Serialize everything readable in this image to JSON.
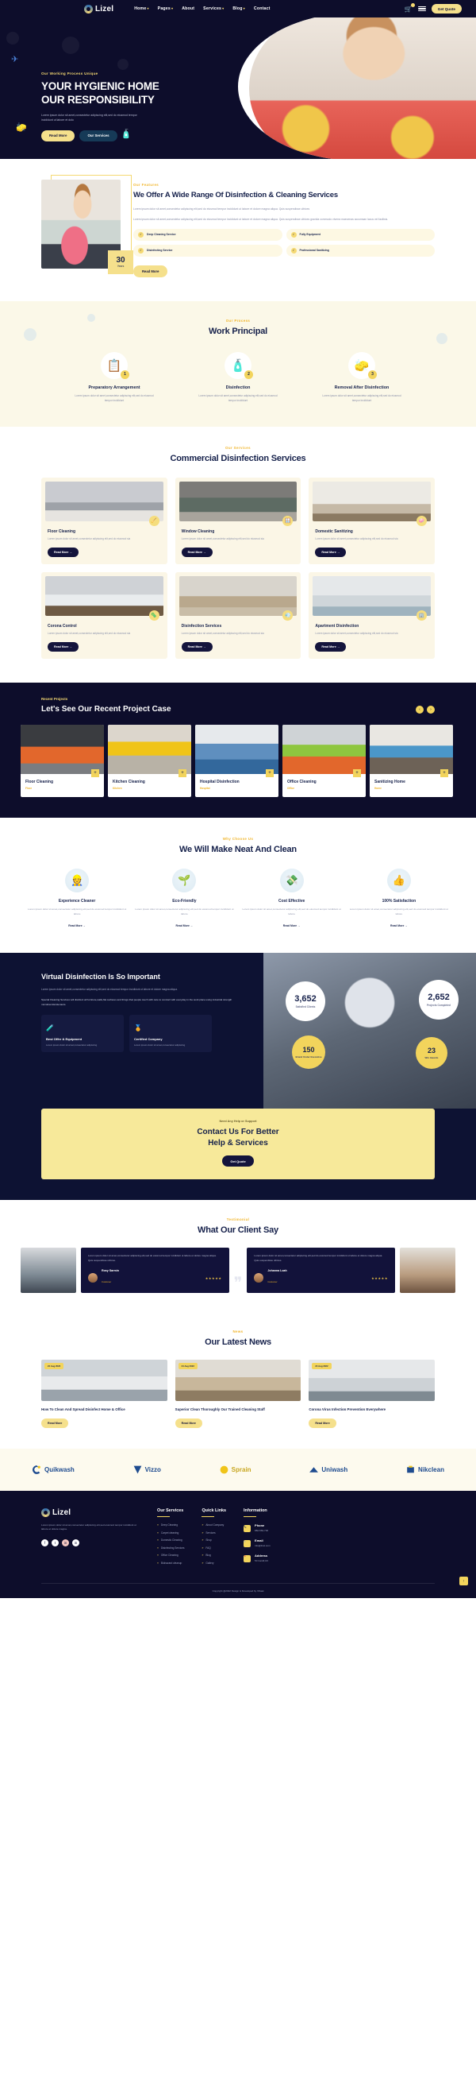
{
  "brand": {
    "name": "Lizel"
  },
  "header": {
    "nav": [
      {
        "label": "Home",
        "caret": "▾"
      },
      {
        "label": "Pages",
        "caret": "▾"
      },
      {
        "label": "About",
        "caret": ""
      },
      {
        "label": "Services",
        "caret": "▾"
      },
      {
        "label": "Blog",
        "caret": "▾"
      },
      {
        "label": "Contact",
        "caret": ""
      }
    ],
    "cart_icon": "🛒",
    "cart_count": "0",
    "quote_label": "Get Quote"
  },
  "hero": {
    "eyebrow": "Our Working Process Unique",
    "title_line1": "YOUR HYGIENIC HOME",
    "title_line2": "OUR RESPONSIBILITY",
    "paragraph": "Lorem ipsum dolor sit amet,consectetur adipiscing elit,sed do eiusmod tempor incididunt ut labore et dolo",
    "btn_primary": "Read More",
    "btn_secondary": "Our Services"
  },
  "offer": {
    "label": "Our Features",
    "title": "We Offer A Wide Range Of Disinfection & Cleaning Services",
    "p1": "Lorem ipsum dolor sit amet,consectetur adipiscing elit,sed do eiusmod tempor incididunt ut labore et dolore magna aliqua. Quis suspendisse ultrices",
    "p2": "Lorem ipsum dolor sit amet,consectetur adipiscing elit,sed do eiusmod tempor incididunt ut labore et dolore magna aliqua. Quis suspendisse ultrices gravida commodo viverra maecenas accumsan lacus vel facilisis.",
    "badge_number": "30",
    "badge_unit": "Years",
    "features": [
      {
        "label": "Deep Cleaning Service",
        "check": "✓"
      },
      {
        "label": "Fully Equipment",
        "check": "✓"
      },
      {
        "label": "Disinfecting Service",
        "check": "✓"
      },
      {
        "label": "Professional Sanitizing",
        "check": "✓"
      }
    ],
    "btn": "Read More"
  },
  "principal": {
    "label": "Our Process",
    "title": "Work Principal",
    "steps": [
      {
        "num": "1",
        "icon": "📋",
        "title": "Preparatory Arrangement",
        "text": "Lorem ipsum dolor sit amet,consectetur adipiscing elit,sed do eiusmod tempor incididunt"
      },
      {
        "num": "2",
        "icon": "🧴",
        "title": "Disinfection",
        "text": "Lorem ipsum dolor sit amet,consectetur adipiscing elit,sed do eiusmod tempor incididunt"
      },
      {
        "num": "3",
        "icon": "🧽",
        "title": "Removal After Disinfection",
        "text": "Lorem ipsum dolor sit amet,consectetur adipiscing elit,sed do eiusmod tempor incididunt"
      }
    ]
  },
  "services": {
    "label": "Our Services",
    "title": "Commercial Disinfection Services",
    "cards": [
      {
        "title": "Floor Cleaning",
        "text": "Lorem ipsum dolor sit amet,consectetur adipiscing elit,sed do eiusmod sia",
        "btn": "Read More  →",
        "icon": "🧹"
      },
      {
        "title": "Window Cleaning",
        "text": "Lorem ipsum dolor sit amet,consectetur adipiscing elit,sed do eiusmod sia",
        "btn": "Read More  →",
        "icon": "🪟"
      },
      {
        "title": "Domestic Sanitizing",
        "text": "Lorem ipsum dolor sit amet,consectetur adipiscing elit,sed do eiusmod sia",
        "btn": "Read More  →",
        "icon": "🧼"
      },
      {
        "title": "Corona Control",
        "text": "Lorem ipsum dolor sit amet,consectetur adipiscing elit,sed do eiusmod sia",
        "btn": "Read More  →",
        "icon": "🦠"
      },
      {
        "title": "Disinfection Services",
        "text": "Lorem ipsum dolor sit amet,consectetur adipiscing elit,sed do eiusmod sia",
        "btn": "Read More  →",
        "icon": "💨"
      },
      {
        "title": "Apartment Disinfection",
        "text": "Lorem ipsum dolor sit amet,consectetur adipiscing elit,sed do eiusmod sia",
        "btn": "Read More  →",
        "icon": "🏢"
      }
    ]
  },
  "projects": {
    "label": "Recent Projects",
    "title": "Let's See Our Recent Project Case",
    "prev": "‹",
    "next": "›",
    "items": [
      {
        "title": "Floor Cleaning",
        "category": "Floor",
        "plus": "+"
      },
      {
        "title": "Kitchen Cleaning",
        "category": "Kitchen",
        "plus": "+"
      },
      {
        "title": "Hospital Disinfection",
        "category": "Hospital",
        "plus": "+"
      },
      {
        "title": "Office Cleaning",
        "category": "Office",
        "plus": "+"
      },
      {
        "title": "Sanitizing Home",
        "category": "Home",
        "plus": "+"
      }
    ]
  },
  "why": {
    "label": "Why Choose Us",
    "title": "We Will Make Neat And Clean",
    "cards": [
      {
        "icon": "👷",
        "title": "Experience Cleaner",
        "text": "Lorem ipsum dolor sit amet,consectetur adipiscing elit,sed do eiusmod tempor incididunt ut labore",
        "link": "Read More  →"
      },
      {
        "icon": "🌱",
        "title": "Eco-Friendly",
        "text": "Lorem ipsum dolor sit amet,consectetur adipiscing elit,sed do eiusmod tempor incididunt ut labore",
        "link": "Read More  →"
      },
      {
        "icon": "💸",
        "title": "Cost Effective",
        "text": "Lorem ipsum dolor sit amet,consectetur adipiscing elit,sed do eiusmod tempor incididunt ut labore",
        "link": "Read More  →"
      },
      {
        "icon": "👍",
        "title": "100% Satisfaction",
        "text": "Lorem ipsum dolor sit amet,consectetur adipiscing elit,sed do eiusmod tempor incididunt ut labore",
        "link": "Read More  →"
      }
    ]
  },
  "virtual": {
    "title": "Virtual Disinfection Is So Important",
    "paragraph": "Lorem ipsum dolor sit amet,consectetur adipiscing elit,sed do eiusmod tempor incididunt ut labore et dolore magna aliqua.",
    "note": "Special Cleaning Services will disinfect all furniture,walls,flat surfaces and things that people touch with care to conduct with everyday in the work place using industrial strength microbial disinfectants.",
    "boxes": [
      {
        "icon": "🧪",
        "title": "Best Offer & Equipment",
        "text": "Lorem ipsum dolor sit amet,consectetur adipiscing"
      },
      {
        "icon": "🏅",
        "title": "Certified Company",
        "text": "Lorem ipsum dolor sit amet,consectetur adipiscing"
      }
    ],
    "stats": [
      {
        "value": "3,652",
        "label": "Satisfied Clients"
      },
      {
        "value": "2,652",
        "label": "Projects Completed"
      },
      {
        "value": "150",
        "label": "Brand Under Executive"
      },
      {
        "value": "23",
        "label": "Win Awards"
      }
    ]
  },
  "cta": {
    "label": "Need Any Help or Support",
    "title_line1": "Contact Us For Better",
    "title_line2": "Help & Services",
    "btn": "Get Quote"
  },
  "testimonial": {
    "label": "Testimonial",
    "title": "What Our Client Say",
    "quote_glyph": "❞",
    "items": [
      {
        "text": "Lorem ipsum dolor sit amet,consectetur adipiscing elit,sed do eiusmod tempor incididunt ut labore et dolore magna aliqua. Quis suspendisse ultrices.",
        "name": "Rosy Sarmin",
        "role": "Customer",
        "stars": "★★★★★"
      },
      {
        "text": "Lorem ipsum dolor sit amet,consectetur adipiscing elit,sed do eiusmod tempor incididunt ut labore et dolore magna aliqua. Quis suspendisse ultrices.",
        "name": "Johanna Loah",
        "role": "Customer",
        "stars": "★★★★★"
      }
    ]
  },
  "news": {
    "label": "News",
    "title": "Our Latest News",
    "items": [
      {
        "date": "24 Aug 2022",
        "title": "How To Clean And Spread Disinfect Home & Office",
        "btn": "Read More"
      },
      {
        "date": "24 Aug 2022",
        "title": "Superior Clean Thoroughly Our Trained Cleaning Staff",
        "btn": "Read More"
      },
      {
        "date": "24 Aug 2022",
        "title": "Corona Virus Infection Prevention Everywhere",
        "btn": "Read More"
      }
    ]
  },
  "brands": [
    {
      "name": "Quikwash"
    },
    {
      "name": "Vizzo"
    },
    {
      "name": "Sprain"
    },
    {
      "name": "Uniwash"
    },
    {
      "name": "Nikclean"
    }
  ],
  "footer": {
    "about_text": "Lorem ipsum dolor sit amet,consectetur adipiscing elit,sed eiusmod tempor incididunt ut labore et dolore magna.",
    "socials": [
      {
        "glyph": "f",
        "name": "facebook"
      },
      {
        "glyph": "t",
        "name": "twitter"
      },
      {
        "glyph": "in",
        "name": "instagram"
      },
      {
        "glyph": "in",
        "name": "linkedin"
      }
    ],
    "services": {
      "heading": "Our Services",
      "items": [
        "Deep Cleaning",
        "Carpet cleaning",
        "Domestic Cleaning",
        "Disinfecting Services",
        "Office Cleaning",
        "Biohazard cleanup"
      ]
    },
    "quick": {
      "heading": "Quick Links",
      "items": [
        "About Company",
        "Services",
        "Shop",
        "FAQ",
        "Blog",
        "Gallery"
      ]
    },
    "information": {
      "heading": "Information",
      "items": [
        {
          "icon": "📞",
          "title": "Phone",
          "value": "882-569-736"
        },
        {
          "icon": "✉",
          "title": "Email",
          "value": "info@lizel.com"
        },
        {
          "icon": "📍",
          "title": "Address",
          "value": "50 Cardif,UK"
        }
      ]
    },
    "copyright": "Copyright @2022 Design & Developed by Vihaat",
    "totop": "↑"
  }
}
